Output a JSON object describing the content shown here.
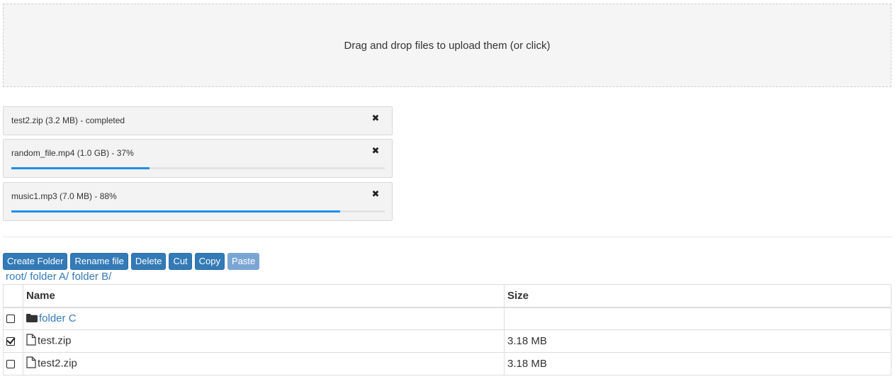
{
  "dropzone": {
    "text": "Drag and drop files to upload them (or click)"
  },
  "uploads": [
    {
      "label": "test2.zip (3.2 MB) - completed",
      "close_glyph": "✖"
    },
    {
      "label": "random_file.mp4 (1.0 GB) - 37%",
      "close_glyph": "✖",
      "progress": 0.37
    },
    {
      "label": "music1.mp3 (7.0 MB) - 88%",
      "close_glyph": "✖",
      "progress": 0.88
    }
  ],
  "toolbar": {
    "create_folder": "Create Folder",
    "rename_file": "Rename file",
    "delete": "Delete",
    "cut": "Cut",
    "copy": "Copy",
    "paste": "Paste"
  },
  "breadcrumb": [
    "root/",
    "folder A/",
    "folder B/"
  ],
  "table": {
    "headers": {
      "name": "Name",
      "size": "Size"
    },
    "rows": [
      {
        "name": "folder C",
        "size": "",
        "type": "folder",
        "icon": "folder-icon",
        "checked": false
      },
      {
        "name": "test.zip",
        "size": "3.18 MB",
        "type": "file",
        "icon": "file-icon",
        "checked": true
      },
      {
        "name": "test2.zip",
        "size": "3.18 MB",
        "type": "file",
        "icon": "file-icon",
        "checked": false
      }
    ]
  },
  "colors": {
    "accent": "#337ab7",
    "progress": "#1e8fe8"
  }
}
